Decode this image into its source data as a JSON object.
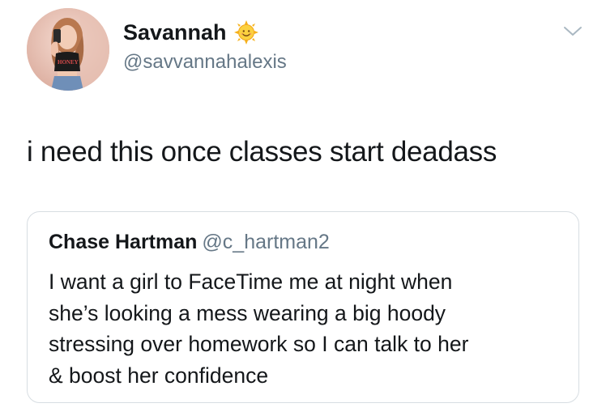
{
  "tweet": {
    "author": {
      "display_name": "Savannah",
      "handle": "@savvannahalexis",
      "name_emoji": "sun-with-face-icon",
      "avatar_shirt_text": "HONEY"
    },
    "text": "i need this once classes start deadass",
    "menu_icon": "chevron-down-icon"
  },
  "quoted_tweet": {
    "author": {
      "display_name": "Chase Hartman",
      "handle": "@c_hartman2"
    },
    "text_lines": [
      "I want a girl to FaceTime me at night when",
      "she’s looking a mess wearing a big hoody",
      "stressing over homework so I can talk to her",
      "& boost her confidence"
    ]
  },
  "colors": {
    "text_primary": "#14171a",
    "text_secondary": "#657786",
    "card_border": "#d7dde2"
  }
}
